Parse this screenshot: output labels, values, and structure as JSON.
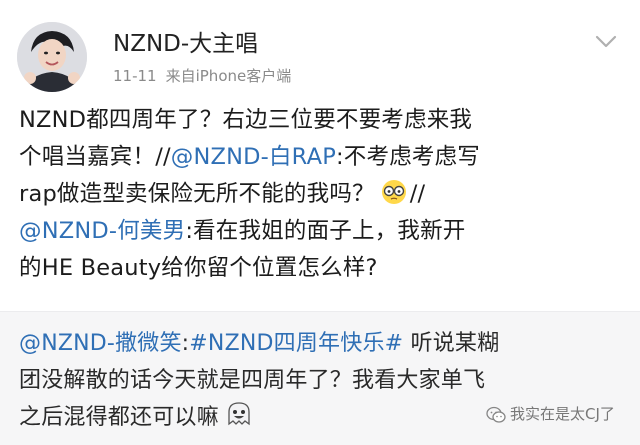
{
  "post_header": {
    "username": "NZND-大主唱",
    "time": "11-11",
    "source": "来自iPhone客户端"
  },
  "post_body": {
    "line1": "NZND都四周年了？右边三位要不要考虑来我",
    "line2_text": "个唱当嘉宾！//",
    "line2_mention": "@NZND-白RAP",
    "line2_after": ":不考虑考虑写",
    "line3_text": "rap做造型卖保险无所不能的我吗？",
    "line3_after": "//",
    "line4_mention": "@NZND-何美男",
    "line4_after": ":看在我姐的面子上，我新开",
    "line5": "的HE Beauty给你留个位置怎么样?"
  },
  "quoted": {
    "mention": "@NZND-撒微笑",
    "colon": ":",
    "hashtag": "#NZND四周年快乐#",
    "line1_after": " 听说某糊",
    "line2": "团没解散的话今天就是四周年了？我看大家单飞",
    "line3": "之后混得都还可以嘛"
  },
  "watermark": {
    "text": "我实在是太CJ了"
  },
  "icons": {
    "avatar": "avatar-photo",
    "menu": "chevron-down-icon",
    "emoji_post": "glasses-emoji-icon",
    "emoji_quote": "grinning-ghost-emoji-icon",
    "watermark": "wechat-logo-icon"
  },
  "colors": {
    "link": "#2f6fb5",
    "meta": "#8a8a8a",
    "quote_bg": "#f6f6f7"
  }
}
